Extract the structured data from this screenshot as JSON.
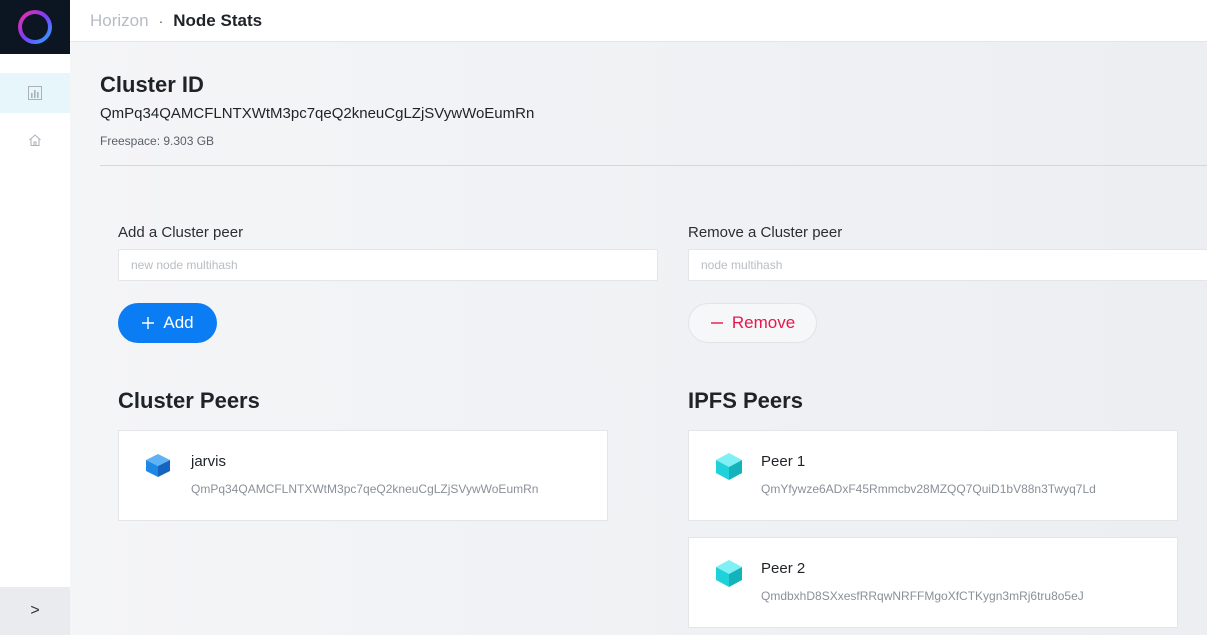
{
  "header": {
    "breadcrumb_root": "Horizon",
    "breadcrumb_separator": "·",
    "breadcrumb_current": "Node Stats"
  },
  "sidebar": {
    "items": [
      {
        "icon": "bar-chart-icon",
        "active": true
      },
      {
        "icon": "home-icon",
        "active": false
      }
    ],
    "toggle_label": ">"
  },
  "cluster": {
    "title": "Cluster ID",
    "id": "QmPq34QAMCFLNTXWtM3pc7qeQ2kneuCgLZjSVywWoEumRn",
    "freespace": "Freespace: 9.303 GB"
  },
  "add_peer": {
    "label": "Add a Cluster peer",
    "placeholder": "new node multihash",
    "value": "",
    "button_label": "Add",
    "button_icon": "plus-icon"
  },
  "remove_peer": {
    "label": "Remove a Cluster peer",
    "placeholder": "node multihash",
    "value": "",
    "button_label": "Remove",
    "button_icon": "minus-icon"
  },
  "cluster_peers": {
    "title": "Cluster Peers",
    "items": [
      {
        "name": "jarvis",
        "hash": "QmPq34QAMCFLNTXWtM3pc7qeQ2kneuCgLZjSVywWoEumRn",
        "icon": "blue-cube-icon"
      }
    ]
  },
  "ipfs_peers": {
    "title": "IPFS Peers",
    "items": [
      {
        "name": "Peer 1",
        "hash": "QmYfywze6ADxF45Rmmcbv28MZQQ7QuiD1bV88n3Twyq7Ld",
        "icon": "cyan-cube-icon"
      },
      {
        "name": "Peer 2",
        "hash": "QmdbxhD8SXxesfRRqwNRFFMgoXfCTKygn3mRj6tru8o5eJ",
        "icon": "cyan-cube-icon"
      }
    ]
  },
  "colors": {
    "accent": "#0a7df5",
    "danger": "#e8174b",
    "cluster_cube": "#1e88e5",
    "ipfs_cube": "#1fd1d9"
  }
}
